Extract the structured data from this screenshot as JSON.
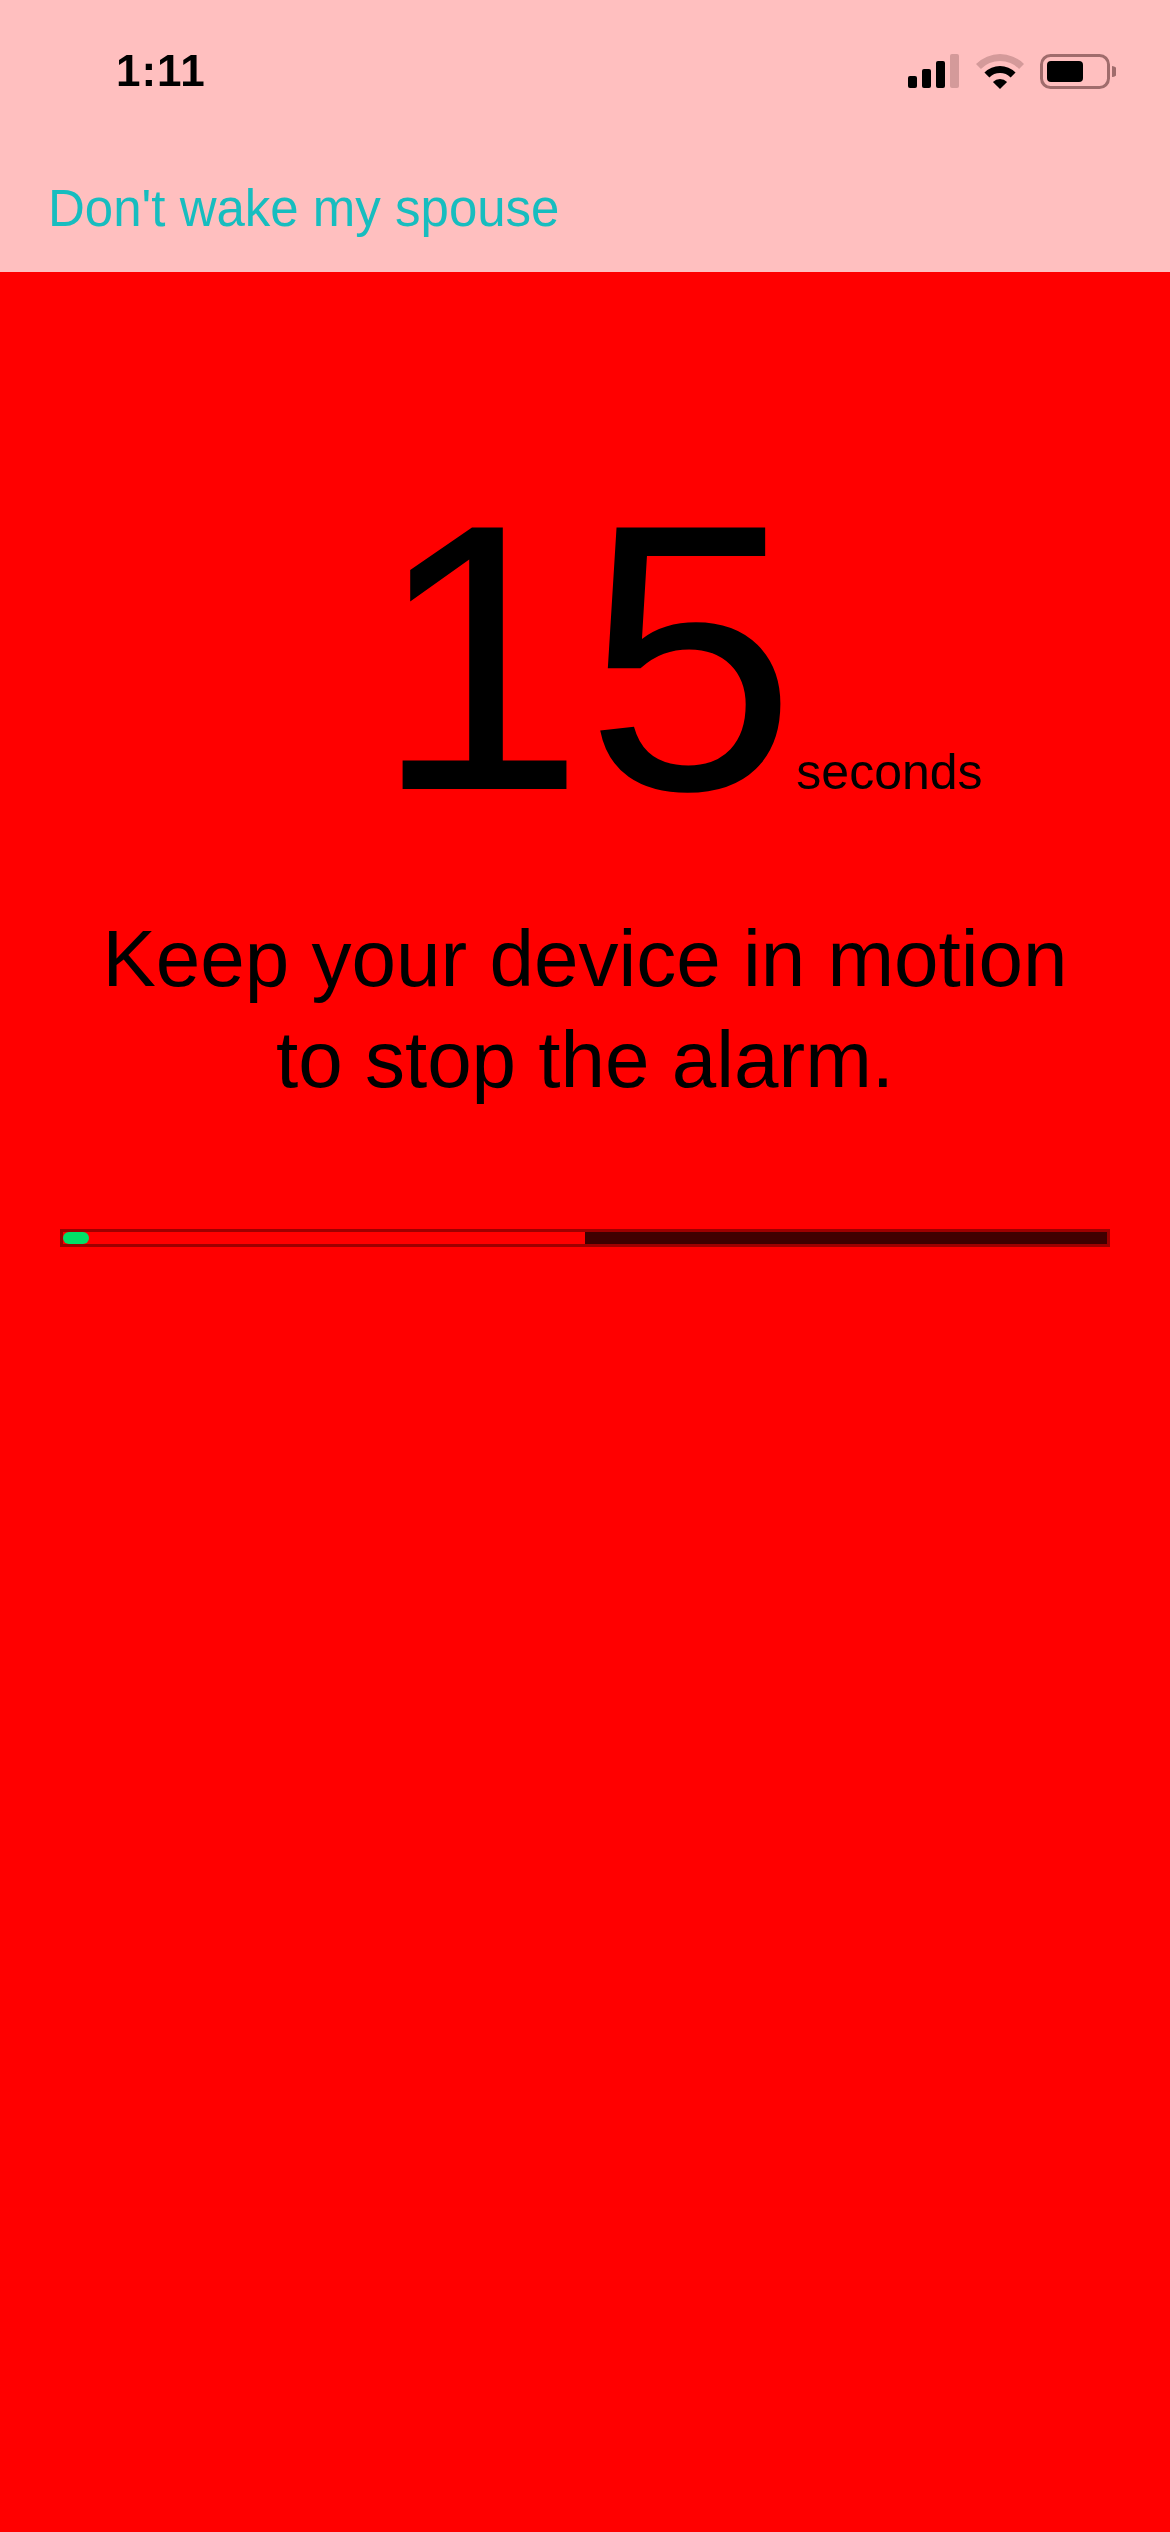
{
  "status_bar": {
    "time": "1:11"
  },
  "nav_bar": {
    "button": "Don't wake my spouse"
  },
  "countdown": {
    "value": "15",
    "unit": "seconds"
  },
  "message": "Keep your device in motion to stop the alarm.",
  "progress": {
    "time_fill": {
      "level": 0.5
    },
    "motion_fill": {
      "level": 0.025
    }
  }
}
